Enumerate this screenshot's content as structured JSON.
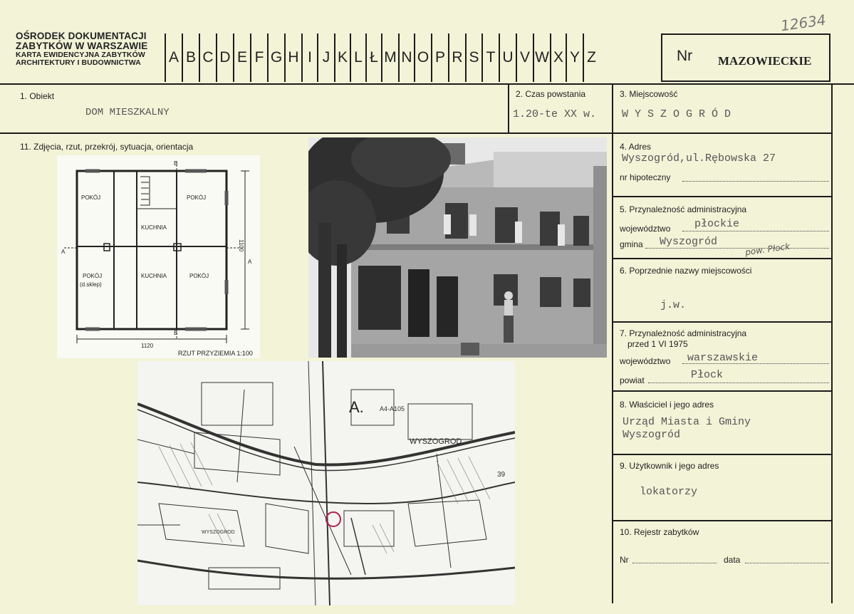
{
  "header": {
    "org_line1": "OŚRODEK DOKUMENTACJI",
    "org_line2": "ZABYTKÓW W WARSZAWIE",
    "org_line3": "KARTA EWIDENCYJNA ZABYTKÓW",
    "org_line4": "ARCHITEKTURY I BUDOWNICTWA",
    "letters": [
      "A",
      "B",
      "C",
      "D",
      "E",
      "F",
      "G",
      "H",
      "I",
      "J",
      "K",
      "L",
      "Ł",
      "M",
      "N",
      "O",
      "P",
      "R",
      "S",
      "T",
      "U",
      "V",
      "W",
      "X",
      "Y",
      "Z"
    ],
    "nr_label": "Nr",
    "region": "MAZOWIECKIE",
    "handwritten_number": "12634"
  },
  "fields": {
    "obiekt_label": "1. Obiekt",
    "obiekt_value": "DOM MIESZKALNY",
    "czas_label": "2. Czas powstania",
    "czas_value": "1.20-te XX w.",
    "miejscowosc_label": "3. Miejscowość",
    "miejscowosc_value": "W Y S Z O G R Ó D",
    "zdjecia_label": "11. Zdjęcia, rzut, przekrój, sytuacja, orientacja",
    "adres_label": "4. Adres",
    "adres_value": "Wyszogród,ul.Rębowska 27",
    "hipoteczny_label": "nr hipoteczny",
    "przynaleznosc_label": "5. Przynależność administracyjna",
    "wojewodztwo_label": "województwo",
    "wojewodztwo_value": "płockie",
    "gmina_label": "gmina",
    "gmina_value": "Wyszogród",
    "gmina_hand": "pow. Płock",
    "poprzednie_label": "6. Poprzednie nazwy miejscowości",
    "poprzednie_value": "j.w.",
    "przyn_1975_label_a": "7. Przynależność administracyjna",
    "przyn_1975_label_b": "przed 1 VI 1975",
    "wojewodztwo2_label": "województwo",
    "wojewodztwo2_value": "warszawskie",
    "powiat_label": "powiat",
    "powiat_value": "Płock",
    "wlasciciel_label": "8. Właściciel i jego adres",
    "wlasciciel_value1": "Urząd Miasta i Gminy",
    "wlasciciel_value2": "Wyszogród",
    "uzytkownik_label": "9. Użytkownik i jego adres",
    "uzytkownik_value": "lokatorzy",
    "rejestr_label": "10. Rejestr zabytków",
    "rejestr_nr_label": "Nr",
    "rejestr_data_label": "data"
  },
  "floorplan": {
    "room_pokoj": "POKÓJ",
    "room_kuchnia": "KUCHNIA",
    "room_sklep": "(d.sklep)",
    "dim_width": "1120",
    "dim_height": "1100",
    "section_a": "A",
    "section_b": "B",
    "caption": "RZUT PRZYZIEMIA 1:100"
  },
  "map": {
    "marker_label": "A.",
    "sheet_label": "A4-A105",
    "town_label": "WYSZOGROD",
    "town_label_small": "WYSZOGROD",
    "grid_number": "39"
  }
}
